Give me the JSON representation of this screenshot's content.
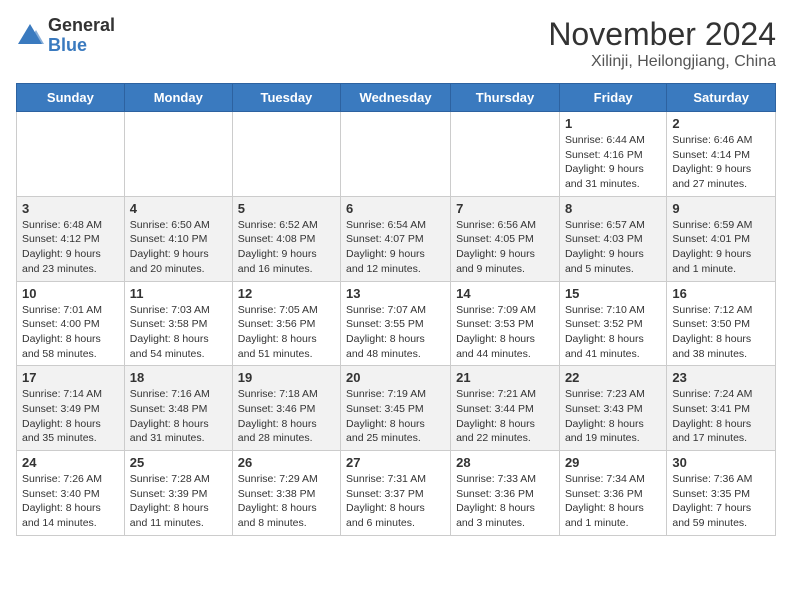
{
  "logo": {
    "general": "General",
    "blue": "Blue"
  },
  "title": "November 2024",
  "location": "Xilinji, Heilongjiang, China",
  "days_of_week": [
    "Sunday",
    "Monday",
    "Tuesday",
    "Wednesday",
    "Thursday",
    "Friday",
    "Saturday"
  ],
  "weeks": [
    [
      {
        "day": "",
        "info": ""
      },
      {
        "day": "",
        "info": ""
      },
      {
        "day": "",
        "info": ""
      },
      {
        "day": "",
        "info": ""
      },
      {
        "day": "",
        "info": ""
      },
      {
        "day": "1",
        "info": "Sunrise: 6:44 AM\nSunset: 4:16 PM\nDaylight: 9 hours and 31 minutes."
      },
      {
        "day": "2",
        "info": "Sunrise: 6:46 AM\nSunset: 4:14 PM\nDaylight: 9 hours and 27 minutes."
      }
    ],
    [
      {
        "day": "3",
        "info": "Sunrise: 6:48 AM\nSunset: 4:12 PM\nDaylight: 9 hours and 23 minutes."
      },
      {
        "day": "4",
        "info": "Sunrise: 6:50 AM\nSunset: 4:10 PM\nDaylight: 9 hours and 20 minutes."
      },
      {
        "day": "5",
        "info": "Sunrise: 6:52 AM\nSunset: 4:08 PM\nDaylight: 9 hours and 16 minutes."
      },
      {
        "day": "6",
        "info": "Sunrise: 6:54 AM\nSunset: 4:07 PM\nDaylight: 9 hours and 12 minutes."
      },
      {
        "day": "7",
        "info": "Sunrise: 6:56 AM\nSunset: 4:05 PM\nDaylight: 9 hours and 9 minutes."
      },
      {
        "day": "8",
        "info": "Sunrise: 6:57 AM\nSunset: 4:03 PM\nDaylight: 9 hours and 5 minutes."
      },
      {
        "day": "9",
        "info": "Sunrise: 6:59 AM\nSunset: 4:01 PM\nDaylight: 9 hours and 1 minute."
      }
    ],
    [
      {
        "day": "10",
        "info": "Sunrise: 7:01 AM\nSunset: 4:00 PM\nDaylight: 8 hours and 58 minutes."
      },
      {
        "day": "11",
        "info": "Sunrise: 7:03 AM\nSunset: 3:58 PM\nDaylight: 8 hours and 54 minutes."
      },
      {
        "day": "12",
        "info": "Sunrise: 7:05 AM\nSunset: 3:56 PM\nDaylight: 8 hours and 51 minutes."
      },
      {
        "day": "13",
        "info": "Sunrise: 7:07 AM\nSunset: 3:55 PM\nDaylight: 8 hours and 48 minutes."
      },
      {
        "day": "14",
        "info": "Sunrise: 7:09 AM\nSunset: 3:53 PM\nDaylight: 8 hours and 44 minutes."
      },
      {
        "day": "15",
        "info": "Sunrise: 7:10 AM\nSunset: 3:52 PM\nDaylight: 8 hours and 41 minutes."
      },
      {
        "day": "16",
        "info": "Sunrise: 7:12 AM\nSunset: 3:50 PM\nDaylight: 8 hours and 38 minutes."
      }
    ],
    [
      {
        "day": "17",
        "info": "Sunrise: 7:14 AM\nSunset: 3:49 PM\nDaylight: 8 hours and 35 minutes."
      },
      {
        "day": "18",
        "info": "Sunrise: 7:16 AM\nSunset: 3:48 PM\nDaylight: 8 hours and 31 minutes."
      },
      {
        "day": "19",
        "info": "Sunrise: 7:18 AM\nSunset: 3:46 PM\nDaylight: 8 hours and 28 minutes."
      },
      {
        "day": "20",
        "info": "Sunrise: 7:19 AM\nSunset: 3:45 PM\nDaylight: 8 hours and 25 minutes."
      },
      {
        "day": "21",
        "info": "Sunrise: 7:21 AM\nSunset: 3:44 PM\nDaylight: 8 hours and 22 minutes."
      },
      {
        "day": "22",
        "info": "Sunrise: 7:23 AM\nSunset: 3:43 PM\nDaylight: 8 hours and 19 minutes."
      },
      {
        "day": "23",
        "info": "Sunrise: 7:24 AM\nSunset: 3:41 PM\nDaylight: 8 hours and 17 minutes."
      }
    ],
    [
      {
        "day": "24",
        "info": "Sunrise: 7:26 AM\nSunset: 3:40 PM\nDaylight: 8 hours and 14 minutes."
      },
      {
        "day": "25",
        "info": "Sunrise: 7:28 AM\nSunset: 3:39 PM\nDaylight: 8 hours and 11 minutes."
      },
      {
        "day": "26",
        "info": "Sunrise: 7:29 AM\nSunset: 3:38 PM\nDaylight: 8 hours and 8 minutes."
      },
      {
        "day": "27",
        "info": "Sunrise: 7:31 AM\nSunset: 3:37 PM\nDaylight: 8 hours and 6 minutes."
      },
      {
        "day": "28",
        "info": "Sunrise: 7:33 AM\nSunset: 3:36 PM\nDaylight: 8 hours and 3 minutes."
      },
      {
        "day": "29",
        "info": "Sunrise: 7:34 AM\nSunset: 3:36 PM\nDaylight: 8 hours and 1 minute."
      },
      {
        "day": "30",
        "info": "Sunrise: 7:36 AM\nSunset: 3:35 PM\nDaylight: 7 hours and 59 minutes."
      }
    ]
  ]
}
